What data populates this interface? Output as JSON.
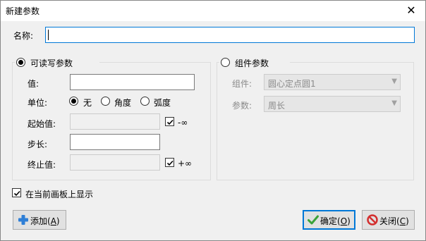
{
  "window": {
    "title": "新建参数",
    "close_glyph": "✕"
  },
  "name_field": {
    "label": "名称:",
    "value": ""
  },
  "rw_group": {
    "radio_label": "可读写参数",
    "selected": true,
    "value_label": "值:",
    "value": "",
    "unit_label": "单位:",
    "units": [
      {
        "label": "无",
        "selected": true
      },
      {
        "label": "角度",
        "selected": false
      },
      {
        "label": "弧度",
        "selected": false
      }
    ],
    "start_label": "起始值:",
    "start_value": "",
    "start_inf_checked": true,
    "start_inf_label": "-∞",
    "step_label": "步长:",
    "step_value": "",
    "end_label": "终止值:",
    "end_value": "",
    "end_inf_checked": true,
    "end_inf_label": "+∞"
  },
  "component_group": {
    "radio_label": "组件参数",
    "selected": false,
    "component_label": "组件:",
    "component_value": "圆心定点圆1",
    "param_label": "参数:",
    "param_value": "周长"
  },
  "show_on_board": {
    "label": "在当前画板上显示",
    "checked": true
  },
  "buttons": {
    "add": {
      "label": "添加",
      "mnemonic": "A"
    },
    "ok": {
      "label": "确定",
      "mnemonic": "O"
    },
    "close": {
      "label": "关闭",
      "mnemonic": "C"
    }
  },
  "colors": {
    "focus_border": "#0078d7",
    "add_icon": "#2f7fd6",
    "ok_icon": "#3aa33a",
    "close_icon": "#d32f2f"
  }
}
